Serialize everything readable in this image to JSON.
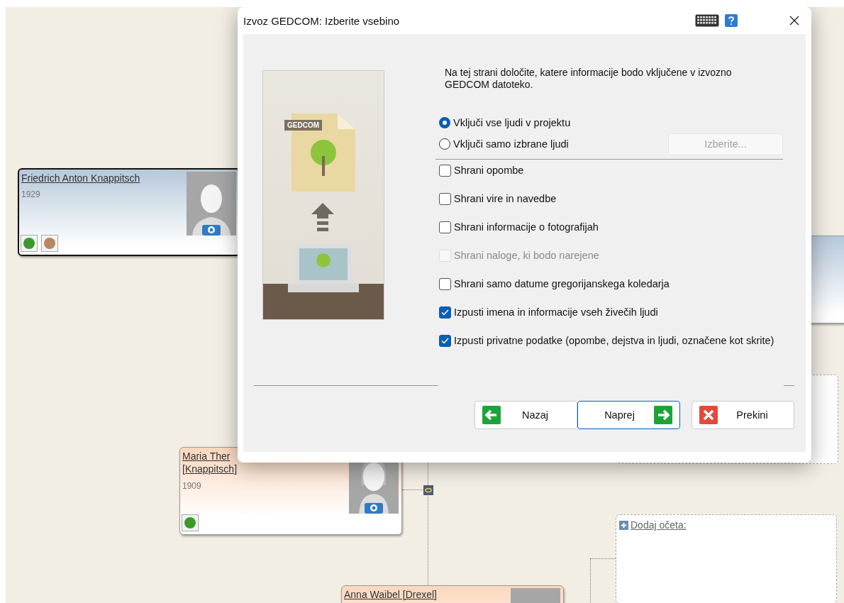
{
  "tree": {
    "people": [
      {
        "kind": "male",
        "name": "Friedrich Anton Knappitsch",
        "year": "1929",
        "selected": true
      },
      {
        "kind": "male",
        "selected": false
      },
      {
        "kind": "female",
        "name": "Maria Ther",
        "name_line_2": "[Knappitsch]",
        "year": "1909",
        "selected": false
      },
      {
        "kind": "female",
        "name": "Anna Waibel [Drexel]",
        "selected": false
      }
    ],
    "add_father": "Dodaj očeta:"
  },
  "dialog": {
    "title": "Izvoz GEDCOM: Izberite vsebino",
    "intro": "Na tej strani določite, katere informacije bodo vključene v izvozno GEDCOM datoteko.",
    "illustration_label": "GEDCOM",
    "scope": [
      {
        "label": "Vključi vse ljudi v projektu",
        "selected": true
      },
      {
        "label": "Vključi samo izbrane ljudi",
        "selected": false
      }
    ],
    "choose_button": {
      "label": "Izberite...",
      "disabled": true
    },
    "options": [
      {
        "label": "Shrani opombe",
        "checked": false,
        "disabled": false
      },
      {
        "label": "Shrani vire in navedbe",
        "checked": false,
        "disabled": false
      },
      {
        "label": "Shrani informacije o fotografijah",
        "checked": false,
        "disabled": false
      },
      {
        "label": "Shrani naloge, ki bodo narejene",
        "checked": false,
        "disabled": true
      },
      {
        "label": "Shrani samo datume gregorijanskega koledarja",
        "checked": false,
        "disabled": false
      },
      {
        "label": "Izpusti imena in informacije vseh živečih ljudi",
        "checked": true,
        "disabled": false
      },
      {
        "label": "Izpusti privatne podatke (opombe, dejstva in ljudi, označene kot skrite)",
        "checked": true,
        "disabled": false
      }
    ],
    "buttons": [
      {
        "kind": "back",
        "label": "Nazaj",
        "focused": false
      },
      {
        "kind": "next",
        "label": "Naprej",
        "focused": true
      },
      {
        "kind": "cancel",
        "label": "Prekini",
        "focused": false
      }
    ]
  }
}
